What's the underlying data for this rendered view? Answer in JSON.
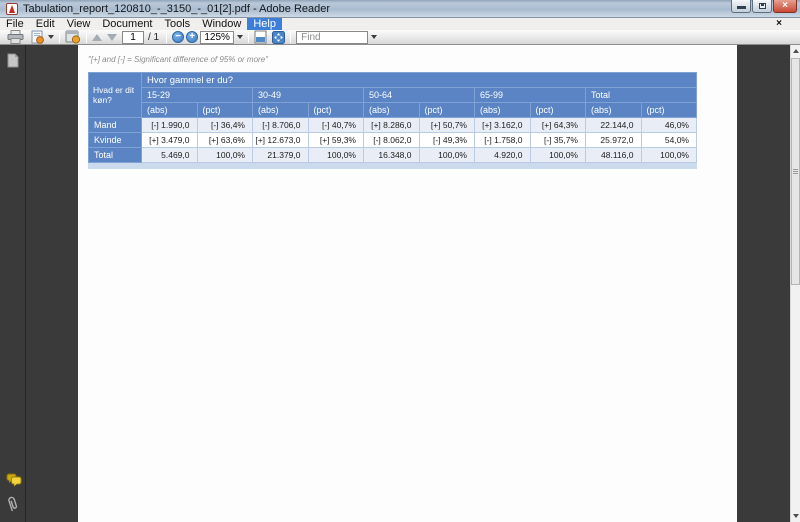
{
  "window": {
    "title": "Tabulation_report_120810_-_3150_-_01[2].pdf - Adobe Reader",
    "controls": {
      "close_glyph": "×"
    }
  },
  "menu_bar": {
    "items": [
      "File",
      "Edit",
      "View",
      "Document",
      "Tools",
      "Window",
      "Help"
    ],
    "active_item": "Help",
    "close_glyph": "×"
  },
  "toolbar": {
    "page_value": "1",
    "page_count_label": "/ 1",
    "zoom_out_glyph": "−",
    "zoom_in_glyph": "+",
    "zoom_value": "125%",
    "find_placeholder": "Find",
    "icons": [
      "printer-icon",
      "email-export-icon",
      "collaborate-icon",
      "previous-page-icon",
      "next-page-icon",
      "zoom-out-icon",
      "zoom-in-icon",
      "scrolling-mode-icon",
      "fullscreen-icon"
    ]
  },
  "nav_pane": {
    "icons": [
      "page-thumbnails-icon",
      "comments-icon",
      "attachments-icon"
    ]
  },
  "pdf_page": {
    "note": "\"[+] and [-] = Significant difference of 95% or more\"",
    "table": {
      "corner_header": "Hvad er dit køn?",
      "group_header": "Hvor gammel er du?",
      "age_groups": [
        "15-29",
        "30-49",
        "50-64",
        "65-99",
        "Total"
      ],
      "sub_headers": [
        "(abs)",
        "(pct)"
      ],
      "rows": [
        {
          "label": "Mand",
          "values": [
            "[-] 1.990,0",
            "[-] 36,4%",
            "[-] 8.706,0",
            "[-] 40,7%",
            "[+] 8.286,0",
            "[+] 50,7%",
            "[+] 3.162,0",
            "[+] 64,3%",
            "22.144,0",
            "46,0%"
          ]
        },
        {
          "label": "Kvinde",
          "values": [
            "[+] 3.479,0",
            "[+] 63,6%",
            "[+] 12.673,0",
            "[+] 59,3%",
            "[-] 8.062,0",
            "[-] 49,3%",
            "[-] 1.758,0",
            "[-] 35,7%",
            "25.972,0",
            "54,0%"
          ]
        },
        {
          "label": "Total",
          "values": [
            "5.469,0",
            "100,0%",
            "21.379,0",
            "100,0%",
            "16.348,0",
            "100,0%",
            "4.920,0",
            "100,0%",
            "48.116,0",
            "100,0%"
          ]
        }
      ]
    }
  },
  "colors": {
    "table_header_blue": "#5a84c4",
    "row_tint": "#e9eef6",
    "table_bottom_strip": "#ccdaee",
    "menu_highlight_blue": "#3d7edb",
    "canvas_background": "#3a3a3a",
    "close_button_red": "#c94834"
  }
}
